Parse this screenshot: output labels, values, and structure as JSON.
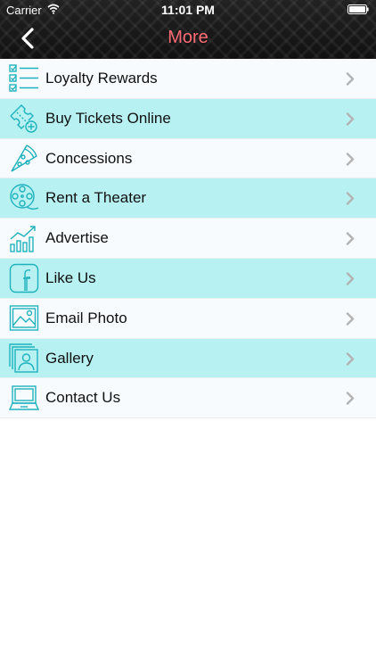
{
  "status": {
    "carrier": "Carrier",
    "time": "11:01 PM"
  },
  "header": {
    "title": "More"
  },
  "colors": {
    "accent": "#1fb2bd",
    "title": "#ff6b74",
    "row_odd": "#f7fbfe",
    "row_even": "#b7f1f2"
  },
  "menu": {
    "items": [
      {
        "label": "Loyalty Rewards",
        "icon": "checklist-icon"
      },
      {
        "label": "Buy Tickets Online",
        "icon": "ticket-plus-icon"
      },
      {
        "label": "Concessions",
        "icon": "pizza-slice-icon"
      },
      {
        "label": "Rent a Theater",
        "icon": "film-reel-icon"
      },
      {
        "label": "Advertise",
        "icon": "growth-chart-icon"
      },
      {
        "label": "Like Us",
        "icon": "facebook-icon"
      },
      {
        "label": "Email Photo",
        "icon": "photo-icon"
      },
      {
        "label": "Gallery",
        "icon": "photo-gallery-icon"
      },
      {
        "label": "Contact Us",
        "icon": "laptop-icon"
      }
    ]
  }
}
